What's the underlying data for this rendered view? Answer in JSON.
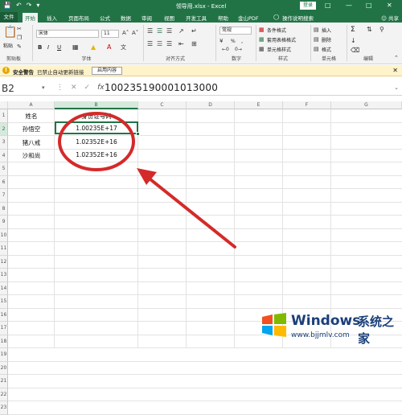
{
  "titlebar": {
    "title": "领导用.xlsx - Excel",
    "login": "登录",
    "qa_icons": [
      "save-icon",
      "undo-icon",
      "redo-icon",
      "customize-icon"
    ]
  },
  "tabs": {
    "file": "文件",
    "items": [
      "开始",
      "插入",
      "页面布局",
      "公式",
      "数据",
      "审阅",
      "视图",
      "开发工具",
      "帮助",
      "金山PDF"
    ],
    "tell_me": "操作说明搜索",
    "share": "共享"
  },
  "ribbon": {
    "clipboard": {
      "paste": "粘贴",
      "label": "剪贴板"
    },
    "font": {
      "name": "宋体",
      "size": "11",
      "bold": "B",
      "italic": "I",
      "underline": "U",
      "label": "字体"
    },
    "alignment": {
      "label": "对齐方式"
    },
    "number": {
      "format": "常规",
      "percent": "%",
      "label": "数字"
    },
    "styles": {
      "conditional": "条件格式",
      "as_table": "套用表格格式",
      "cell_styles": "单元格样式",
      "label": "样式"
    },
    "cells": {
      "insert": "插入",
      "delete": "删除",
      "format": "格式",
      "label": "单元格"
    },
    "editing": {
      "sum": "Σ",
      "label": "编辑"
    }
  },
  "infobar": {
    "title": "安全警告",
    "message": "已禁止自动更新链接",
    "button": "启用内容"
  },
  "formula_bar": {
    "name_box": "B2",
    "value": "100235190001013000"
  },
  "sheet": {
    "columns": [
      "A",
      "B",
      "C",
      "D",
      "E",
      "F",
      "G"
    ],
    "selected_column": "B",
    "rows": [
      "1",
      "2",
      "3",
      "4",
      "5",
      "6",
      "7",
      "8",
      "9",
      "10",
      "11",
      "12",
      "13",
      "14",
      "15",
      "16",
      "17",
      "18",
      "19",
      "20",
      "21",
      "22",
      "23"
    ],
    "selected_row": "2",
    "header": {
      "a": "姓名",
      "b": "身份证号码"
    },
    "data": [
      {
        "name": "孙悟空",
        "id": "1.00235E+17"
      },
      {
        "name": "猪八戒",
        "id": "1.02352E+16"
      },
      {
        "name": "沙和尚",
        "id": "1.02352E+16"
      }
    ]
  },
  "annotation": {
    "color": "#d42a2a"
  },
  "watermark": {
    "brand": "Windows",
    "cn": "系统之家",
    "url": "www.bjjmlv.com"
  },
  "colors": {
    "accent": "#217346",
    "warn_bg": "#fff3ca"
  }
}
